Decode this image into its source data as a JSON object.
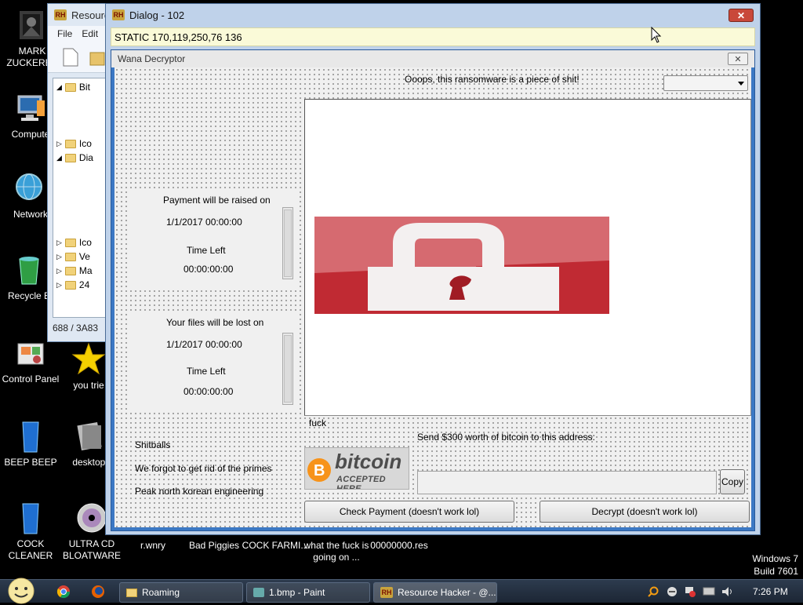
{
  "desktop": {
    "icons": [
      {
        "label": "MARK ZUCKERBE",
        "icon": "user-folder-icon"
      },
      {
        "label": "Compute",
        "icon": "computer-icon"
      },
      {
        "label": "Network",
        "icon": "network-icon"
      },
      {
        "label": "Recycle B",
        "icon": "recycle-bin-icon"
      },
      {
        "label": "Control Panel",
        "icon": "control-panel-icon"
      },
      {
        "label": "you trie",
        "icon": "star-icon"
      },
      {
        "label": "BEEP BEEP",
        "icon": "bin-blue-icon"
      },
      {
        "label": "desktop.",
        "icon": "file-icon"
      },
      {
        "label": "COCK CLEANER",
        "icon": "bin-blue-icon"
      },
      {
        "label": "ULTRA CD BLOATWARE",
        "icon": "cd-icon"
      },
      {
        "label": "r.wnry",
        "icon": "file-icon"
      },
      {
        "label": "Bad Piggies",
        "icon": "game-icon"
      },
      {
        "label": "COCK FARMI...",
        "icon": "file-icon"
      },
      {
        "label": "what the fuck is going on ...",
        "icon": "file-icon"
      },
      {
        "label": "00000000.res",
        "icon": "file-icon"
      }
    ],
    "winver": {
      "line1": "Windows 7",
      "line2": "Build 7601"
    }
  },
  "rh_window": {
    "title": "Resourc",
    "menu": [
      "File",
      "Edit"
    ],
    "tree": [
      "Bit",
      "Ico",
      "Dia",
      "Ico",
      "Ve",
      "Ma",
      "24"
    ],
    "status": "688 / 3A83"
  },
  "dialog": {
    "title": "Dialog - 102",
    "static_bar": "STATIC  170,119,250,76  136",
    "inner_title": "Wana Decryptor",
    "header_text": "Ooops, this ransomware is a piece of shit!",
    "combo_value": "",
    "payment": {
      "raised_label": "Payment will be raised on",
      "raised_date": "1/1/2017 00:00:00",
      "time_left_label": "Time Left",
      "time_left_value": "00:00:00:00"
    },
    "lost": {
      "lost_label": "Your files will be lost on",
      "lost_date": "1/1/2017 00:00:00",
      "time_left_label": "Time Left",
      "time_left_value": "00:00:00:00"
    },
    "side_texts": [
      "Shitballs",
      "We forgot to get rid of the primes",
      "Peak north korean engineering"
    ],
    "fuck_label": "fuck",
    "bitcoin_word": "bitcoin",
    "bitcoin_sub": "ACCEPTED HERE",
    "send_label": "Send $300 worth of bitcoin to this address:",
    "address_value": "",
    "copy_button": "Copy",
    "check_button": "Check Payment (doesn't work lol)",
    "decrypt_button": "Decrypt (doesn't work lol)"
  },
  "taskbar": {
    "tasks": [
      "Roaming",
      "1.bmp - Paint",
      "Resource Hacker - @..."
    ],
    "clock": "7:26 PM"
  },
  "colors": {
    "lock_red": "#c02a33",
    "bitcoin_orange": "#f7931a",
    "static_yellow": "#fafad8"
  }
}
